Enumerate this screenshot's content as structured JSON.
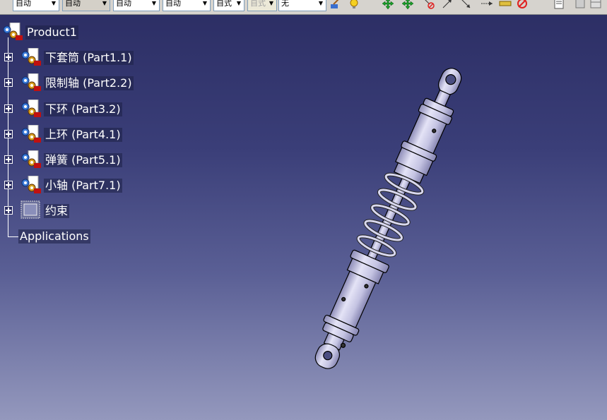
{
  "toolbar": {
    "combos": [
      {
        "value": "自动",
        "state": "normal"
      },
      {
        "value": "自动",
        "state": "sunken"
      },
      {
        "value": "自动",
        "state": "normal"
      },
      {
        "value": "自动",
        "state": "normal"
      },
      {
        "value": "自式",
        "state": "normal"
      },
      {
        "value": "自式",
        "state": "disabled"
      },
      {
        "value": "无",
        "state": "normal"
      }
    ],
    "icons": [
      "paint-brush-icon",
      "light-bulb-icon",
      "move-cross-icon",
      "snap-move-icon",
      "no-constraint-icon",
      "arrow-up-right-icon",
      "arrow-down-right-icon",
      "arrow-right-icon",
      "ruler-icon",
      "no-symbol-icon",
      "properties-icon",
      "tools-icon"
    ]
  },
  "tree": {
    "root": "Product1",
    "parts": [
      {
        "label": "下套筒 (Part1.1)"
      },
      {
        "label": "限制轴 (Part2.2)"
      },
      {
        "label": "下环 (Part3.2)"
      },
      {
        "label": "上环 (Part4.1)"
      },
      {
        "label": "弹簧 (Part5.1)"
      },
      {
        "label": "小轴 (Part7.1)"
      }
    ],
    "constraints": "约束",
    "applications": "Applications"
  },
  "colors": {
    "background_top": "#2b2d63",
    "background_bottom": "#9498bd",
    "model_fill": "#c9c8e6",
    "model_stroke": "#000000"
  }
}
